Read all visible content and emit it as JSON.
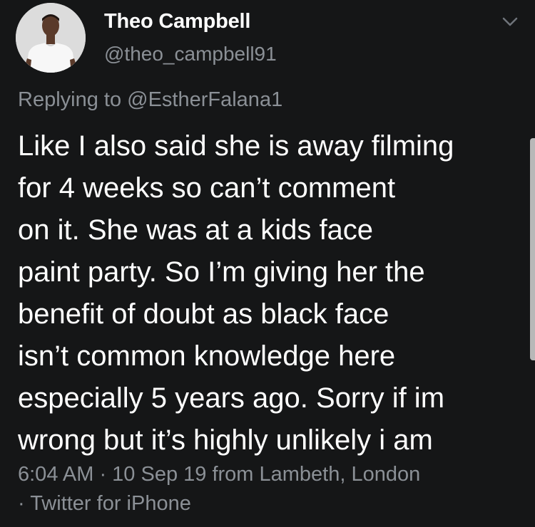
{
  "tweet": {
    "display_name": "Theo Campbell",
    "handle": "@theo_campbell91",
    "replying_to": "Replying to @EstherFalana1",
    "body_lines": [
      "Like I also said she is away filming",
      "for 4 weeks so can’t comment",
      "on it. She was at a kids face",
      "paint party. So I’m giving her the",
      "benefit of doubt as black face",
      "isn’t common knowledge here",
      "especially 5 years ago. Sorry if im",
      "wrong but it’s highly unlikely i am"
    ],
    "meta_line_1": "6:04 AM · 10 Sep 19 from Lambeth, London",
    "meta_line_2": "· Twitter for iPhone"
  },
  "icons": {
    "avatar": "profile-photo",
    "menu": "chevron-down-icon"
  },
  "colors": {
    "background": "#151617",
    "text": "#ffffff",
    "secondary_text": "#8b9096"
  }
}
